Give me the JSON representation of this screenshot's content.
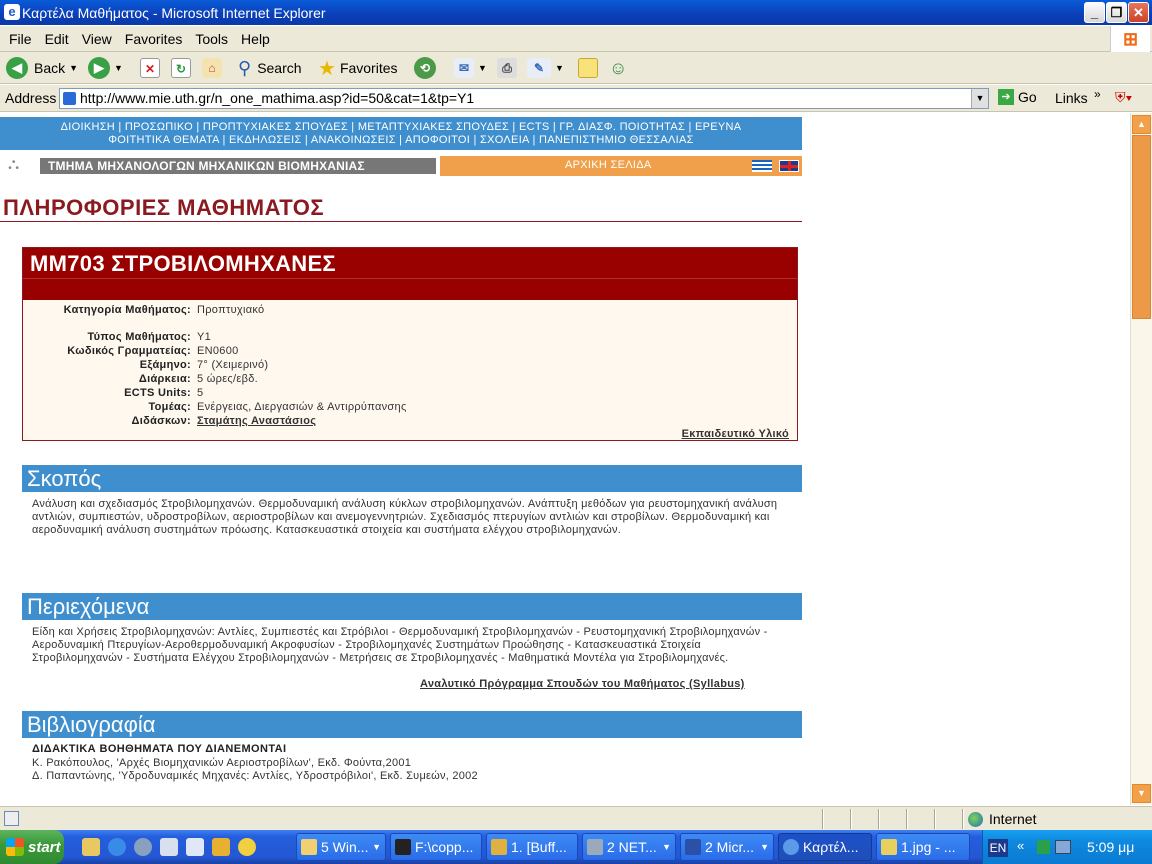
{
  "window": {
    "title": "Καρτέλα Μαθήματος - Microsoft Internet Explorer",
    "min_label": "_",
    "max_label": "❐",
    "close_label": "✕"
  },
  "menu": [
    "File",
    "Edit",
    "View",
    "Favorites",
    "Tools",
    "Help"
  ],
  "toolbar": {
    "back": "Back",
    "search": "Search",
    "favorites": "Favorites"
  },
  "address": {
    "label": "Address",
    "url": "http://www.mie.uth.gr/n_one_mathima.asp?id=50&cat=1&tp=Y1",
    "go": "Go",
    "links": "Links",
    "more": "»"
  },
  "nav": {
    "line1": "ΔΙΟΙΚΗΣΗ | ΠΡΟΣΩΠΙΚΟ | ΠΡΟΠΤΥΧΙΑΚΕΣ ΣΠΟΥΔΕΣ | ΜΕΤΑΠΤΥΧΙΑΚΕΣ ΣΠΟΥΔΕΣ | ECTS | ΓΡ. ΔΙΑΣΦ. ΠΟΙΟΤΗΤΑΣ | ΕΡΕΥΝΑ",
    "line2": "ΦΟΙΤΗΤΙΚΑ ΘΕΜΑΤΑ | ΕΚΔΗΛΩΣΕΙΣ | ΑΝΑΚΟΙΝΩΣΕΙΣ | ΑΠΟΦΟΙΤΟΙ | ΣΧΟΛΕΙΑ | ΠΑΝΕΠΙΣΤΗΜΙΟ ΘΕΣΣΑΛΙΑΣ"
  },
  "dept": {
    "name": "ΤΜΗΜΑ ΜΗΧΑΝΟΛΟΓΩΝ ΜΗΧΑΝΙΚΩΝ ΒΙΟΜΗΧΑΝΙΑΣ",
    "home": "ΑΡΧΙΚΗ ΣΕΛΙΔΑ"
  },
  "page_title": "ΠΛΗΡΟΦΟΡΙΕΣ ΜΑΘΗΜΑΤΟΣ",
  "course": {
    "title": "ΜΜ703 ΣΤΡΟΒΙΛΟΜΗΧΑΝΕΣ",
    "fields": [
      {
        "key": "Κατηγορία Μαθήματος:",
        "value": "Προπτυχιακό"
      },
      {
        "key": "Τύπος Μαθήματος:",
        "value": "Y1"
      },
      {
        "key": "Κωδικός Γραμματείας:",
        "value": "ΕΝ0600"
      },
      {
        "key": "Εξάμηνο:",
        "value": "7° (Χειμερινό)"
      },
      {
        "key": "Διάρκεια:",
        "value": "5 ώρες/εβδ."
      },
      {
        "key": "ECTS Units:",
        "value": "5"
      },
      {
        "key": "Τομέας:",
        "value": "Ενέργειας, Διεργασιών & Αντιρρύπανσης"
      },
      {
        "key": "Διδάσκων:",
        "value": "Σταμάτης Αναστάσιος"
      }
    ],
    "edu_link": "Εκπαιδευτικό Υλικό"
  },
  "sections": {
    "skopos": {
      "title": "Σκοπός",
      "text": "Ανάλυση και σχεδιασμός Στροβιλομηχανών. Θερμοδυναμική ανάλυση κύκλων στροβιλομηχανών. Ανάπτυξη μεθόδων για ρευστομηχανική ανάλυση αντλιών, συμπιεστών, υδροστροβίλων, αεριοστροβίλων και ανεμογεννητριών.  Σχεδιασμός πτερυγίων αντλιών και στροβίλων.  Θερμοδυναμική και αεροδυναμική ανάλυση συστημάτων πρόωσης. Κατασκευαστικά στοιχεία και συστήματα ελέγχου στροβιλομηχανών."
    },
    "periexomena": {
      "title": "Περιεχόμενα",
      "text": "Είδη και Χρήσεις Στροβιλομηχανών: Αντλίες, Συμπιεστές και Στρόβιλοι - Θερμοδυναμική Στροβιλομηχανών - Ρευστομηχανική Στροβιλομηχανών - Αεροδυναμική Πτερυγίων-Αεροθερμοδυναμική Ακροφυσίων - Στροβιλομηχανές Συστημάτων Προώθησης - Κατασκευαστικά Στοιχεία Στροβιλομηχανών - Συστήματα Ελέγχου Στροβιλομηχανών - Μετρήσεις σε Στροβιλομηχανές - Μαθηματικά Μοντέλα για Στροβιλομηχανές.",
      "syllabus_link": "Αναλυτικό Πρόγραμμα Σπουδών του Μαθήματος (Syllabus)"
    },
    "bibliografia": {
      "title": "Βιβλιογραφία",
      "subhead": "ΔΙΔΑΚΤΙΚΑ ΒΟΗΘΗΜΑΤΑ ΠΟΥ ΔΙΑΝΕΜΟΝΤΑΙ",
      "items": [
        "Κ. Ρακόπουλος, 'Αρχές Βιομηχανικών Αεριοστροβίλων', Εκδ. Φούντα,2001",
        "Δ. Παπαντώνης, 'Υδροδυναμικές Μηχανές: Αντλίες, Υδροστρόβιλοι', Εκδ. Συμεών, 2002"
      ]
    }
  },
  "status": {
    "zone": "Internet"
  },
  "taskbar": {
    "start": "start",
    "buttons": [
      {
        "label": "5 Win...",
        "arrow": "▼"
      },
      {
        "label": "F:\\copp...",
        "arrow": ""
      },
      {
        "label": "1. [Buff...",
        "arrow": ""
      },
      {
        "label": "2 NET...",
        "arrow": "▼"
      },
      {
        "label": "2 Micr...",
        "arrow": "▼"
      },
      {
        "label": "Καρτέλ...",
        "arrow": ""
      },
      {
        "label": "1.jpg - ...",
        "arrow": ""
      }
    ],
    "lang": "EN",
    "chev": "«",
    "clock": "5:09 μμ"
  },
  "colors": {
    "nav_blue": "#3f8fcf",
    "dept_orange": "#f0a04b",
    "course_red": "#990000",
    "title_maroon": "#8a1a20"
  }
}
